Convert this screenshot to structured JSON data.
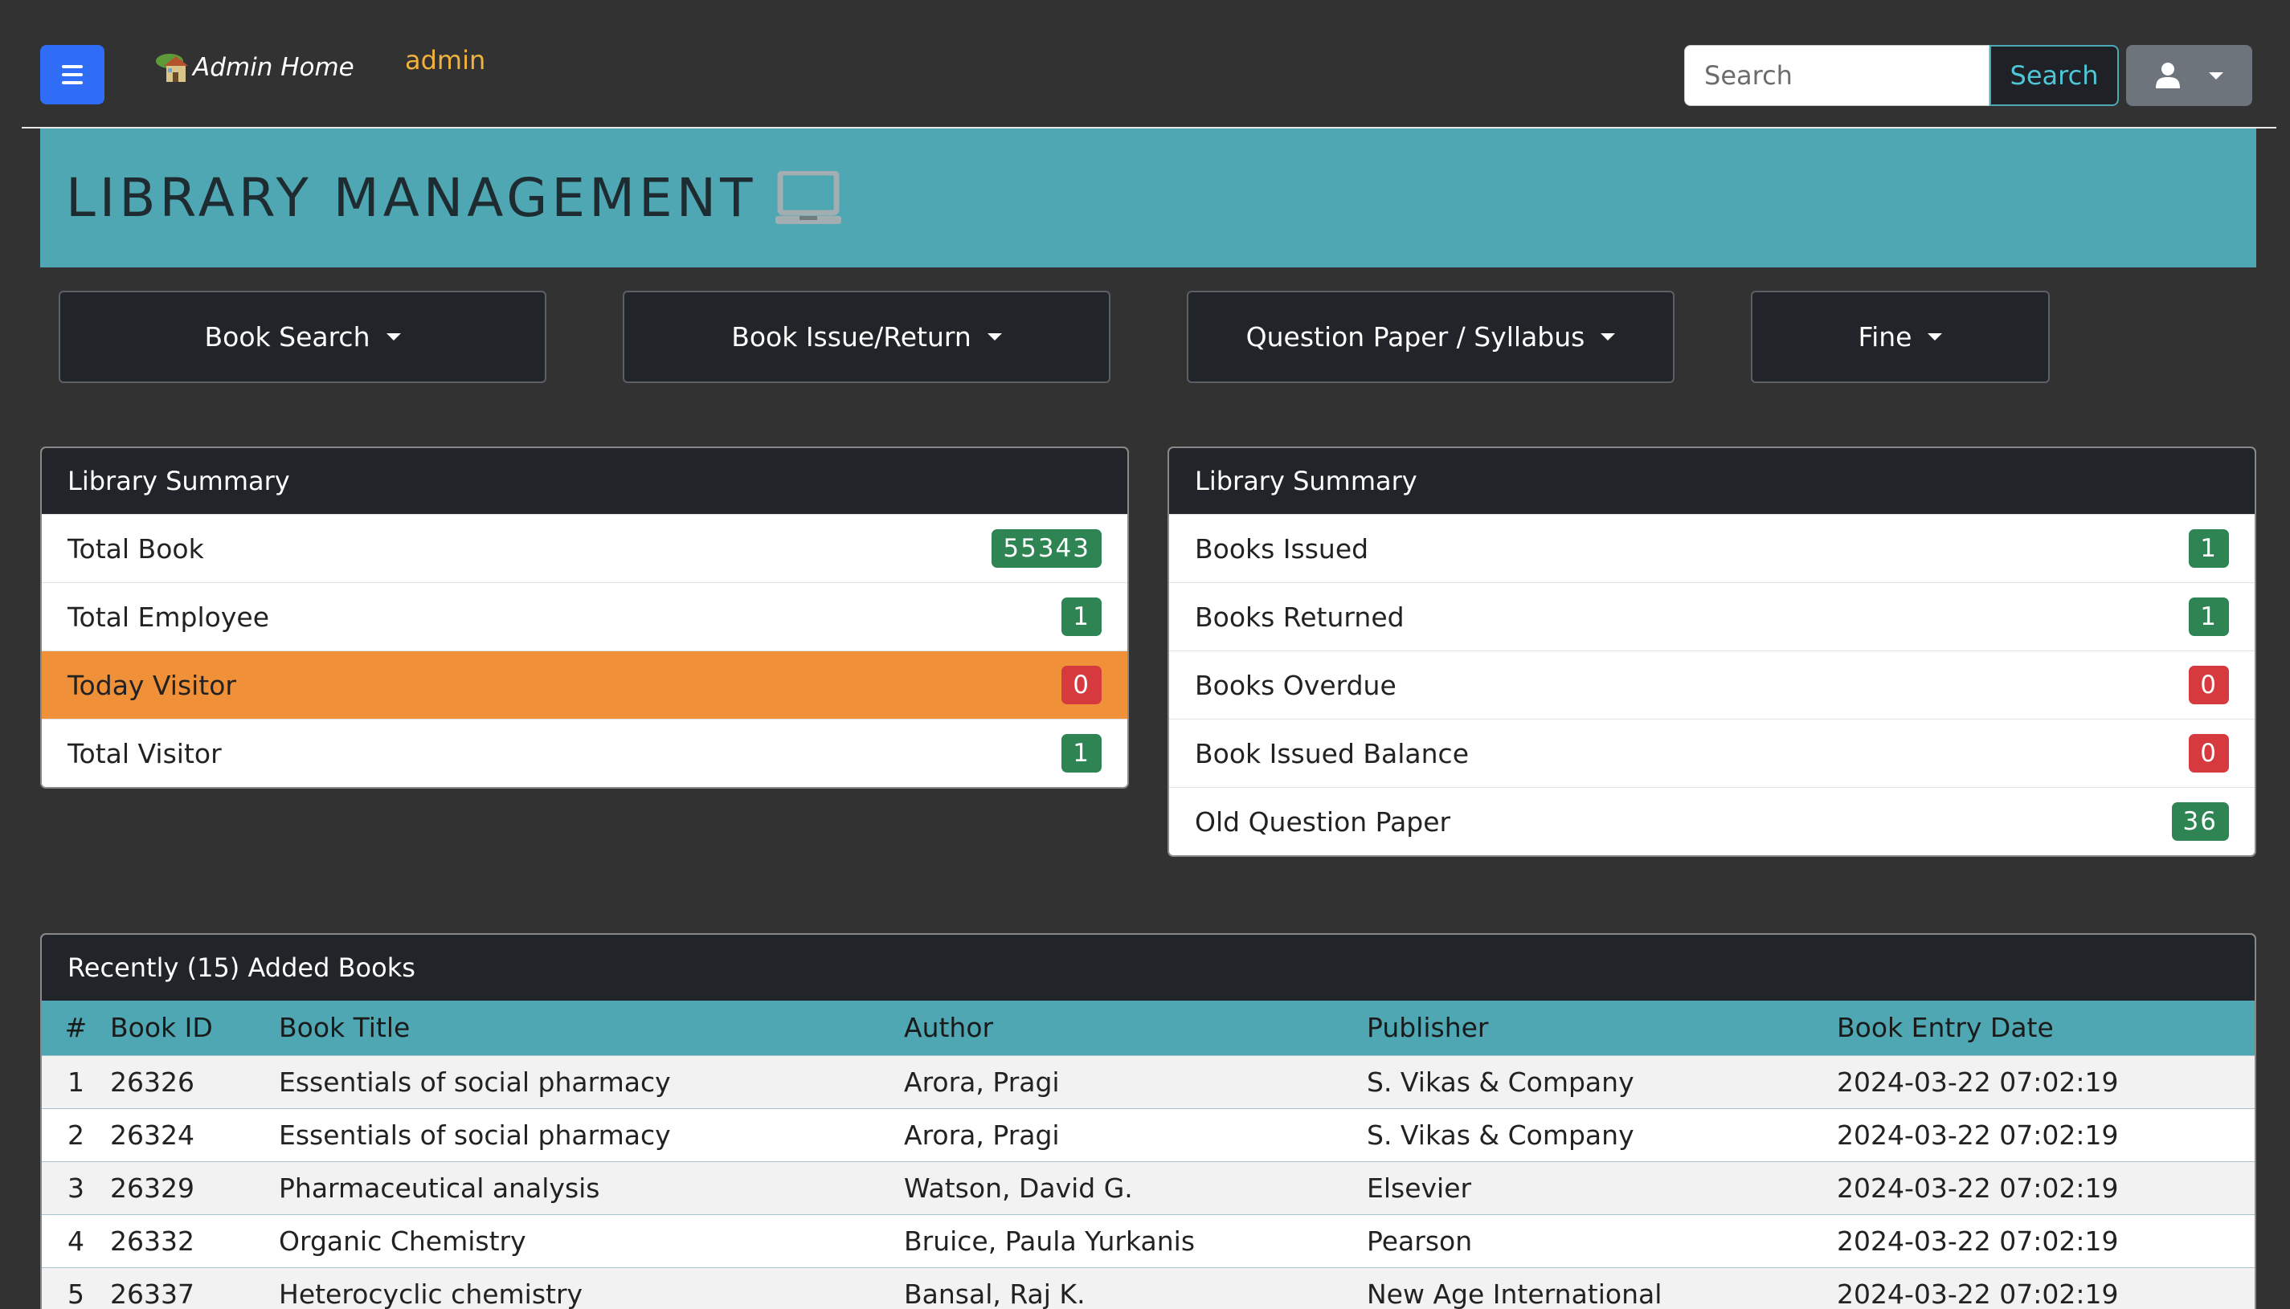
{
  "nav": {
    "home_label": "Admin Home",
    "user_name": "admin",
    "search_placeholder": "Search",
    "search_button": "Search"
  },
  "banner": {
    "title": "LIBRARY MANAGEMENT"
  },
  "menus": [
    {
      "label": "Book Search"
    },
    {
      "label": "Book Issue/Return"
    },
    {
      "label": "Question Paper / Syllabus"
    },
    {
      "label": "Fine"
    }
  ],
  "summary_left": {
    "title": "Library Summary",
    "rows": [
      {
        "label": "Total Book",
        "value": "55343",
        "color": "#2e8553"
      },
      {
        "label": "Total Employee",
        "value": "1",
        "color": "#2e8553"
      },
      {
        "label": "Today Visitor",
        "value": "0",
        "color": "#d63a3f"
      },
      {
        "label": "Total Visitor",
        "value": "1",
        "color": "#2e8553"
      }
    ]
  },
  "summary_right": {
    "title": "Library Summary",
    "rows": [
      {
        "label": "Books Issued",
        "value": "1",
        "color": "#2e8553"
      },
      {
        "label": "Books Returned",
        "value": "1",
        "color": "#2e8553"
      },
      {
        "label": "Books Overdue",
        "value": "0",
        "color": "#d63a3f"
      },
      {
        "label": "Book Issued Balance",
        "value": "0",
        "color": "#d63a3f"
      },
      {
        "label": "Old Question Paper",
        "value": "36",
        "color": "#2e8553"
      }
    ]
  },
  "recent_books": {
    "title": "Recently (15) Added Books",
    "columns": [
      "#",
      "Book ID",
      "Book Title",
      "Author",
      "Publisher",
      "Book Entry Date"
    ],
    "rows": [
      [
        "1",
        "26326",
        "Essentials of social pharmacy",
        "Arora, Pragi",
        "S. Vikas & Company",
        "2024-03-22 07:02:19"
      ],
      [
        "2",
        "26324",
        "Essentials of social pharmacy",
        "Arora, Pragi",
        "S. Vikas & Company",
        "2024-03-22 07:02:19"
      ],
      [
        "3",
        "26329",
        "Pharmaceutical analysis",
        "Watson, David G.",
        "Elsevier",
        "2024-03-22 07:02:19"
      ],
      [
        "4",
        "26332",
        "Organic Chemistry",
        "Bruice, Paula Yurkanis",
        "Pearson",
        "2024-03-22 07:02:19"
      ],
      [
        "5",
        "26337",
        "Heterocyclic chemistry",
        "Bansal, Raj K.",
        "New Age International",
        "2024-03-22 07:02:19"
      ]
    ]
  },
  "colors": {
    "accent_teal": "#4ea7b2",
    "primary_blue": "#2f6df6",
    "highlight_orange": "#f0913a",
    "user_name_yellow": "#f0b23c"
  }
}
